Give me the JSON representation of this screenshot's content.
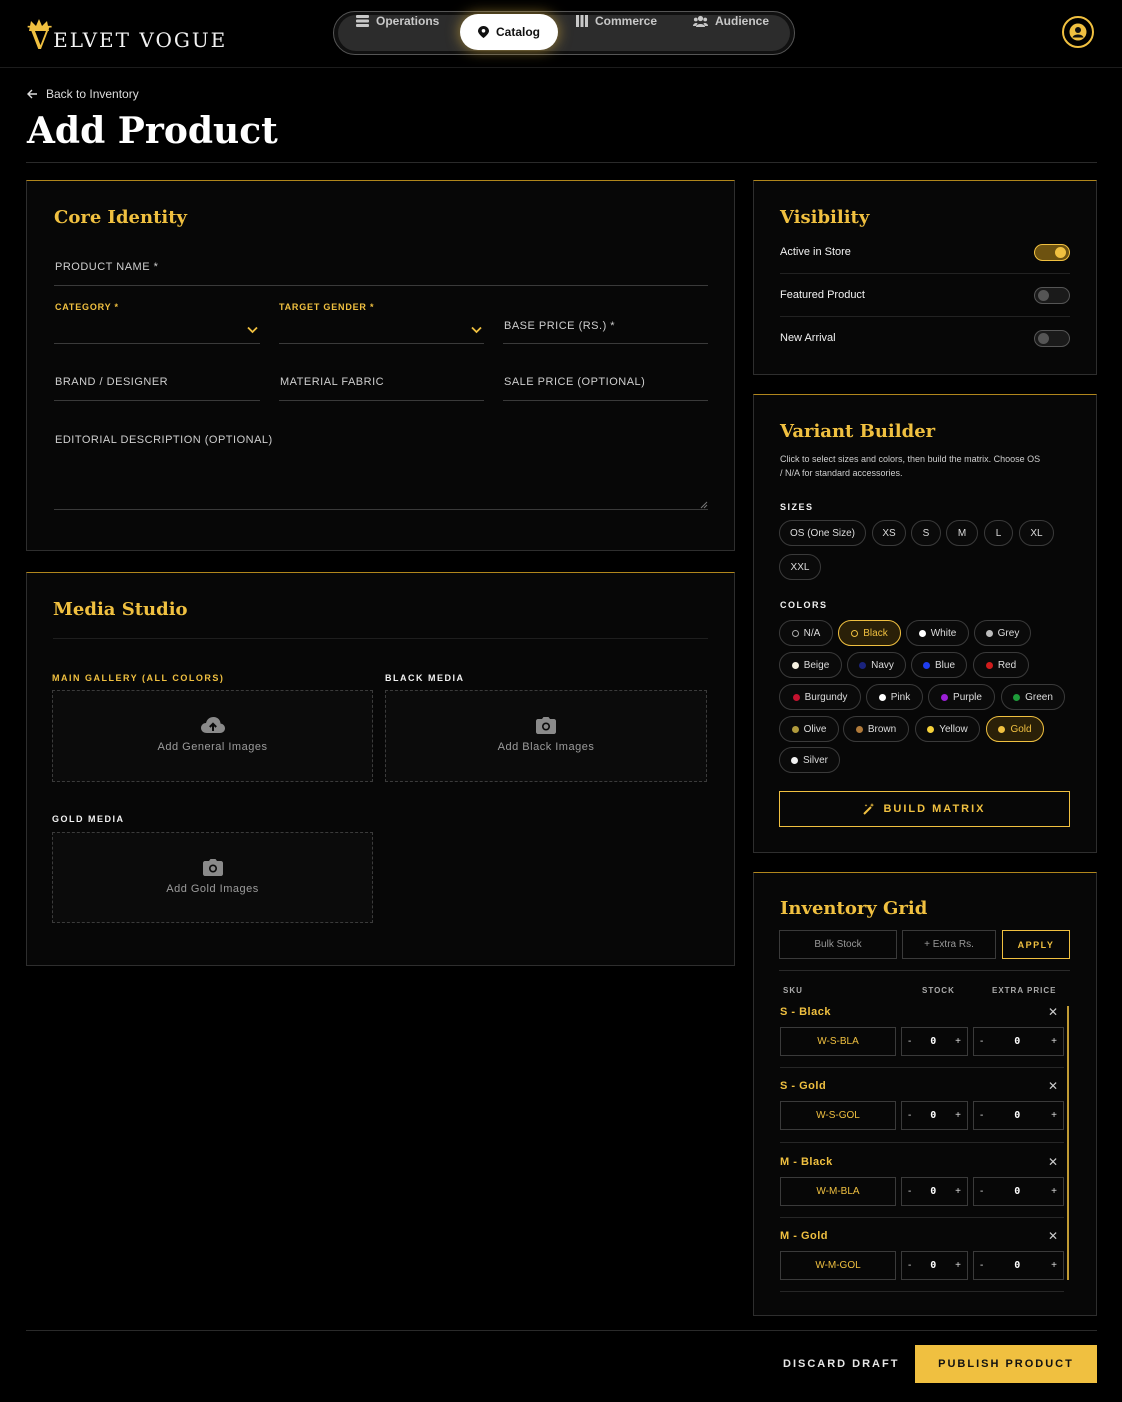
{
  "brand": {
    "first_letter": "V",
    "rest": "ELVET VOGUE"
  },
  "nav": {
    "tabs": [
      {
        "label": "Operations",
        "icon": "layers-icon"
      },
      {
        "label": "Catalog",
        "icon": "tag-icon",
        "active": true
      },
      {
        "label": "Commerce",
        "icon": "columns-icon"
      },
      {
        "label": "Audience",
        "icon": "users-icon"
      }
    ]
  },
  "page": {
    "back_label": "Back to Inventory",
    "title": "Add Product"
  },
  "core": {
    "title": "Core Identity",
    "product_name_label": "PRODUCT NAME *",
    "category_label": "CATEGORY *",
    "target_gender_label": "TARGET GENDER *",
    "base_price_label": "BASE PRICE (RS.) *",
    "brand_label": "BRAND / DESIGNER",
    "material_label": "MATERIAL FABRIC",
    "sale_price_label": "SALE PRICE (OPTIONAL)",
    "description_label": "EDITORIAL DESCRIPTION (OPTIONAL)"
  },
  "media": {
    "title": "Media Studio",
    "main_label": "MAIN GALLERY (ALL COLORS)",
    "main_add": "Add General Images",
    "black_label": "BLACK MEDIA",
    "black_add": "Add Black Images",
    "gold_label": "GOLD MEDIA",
    "gold_add": "Add Gold Images"
  },
  "visibility": {
    "title": "Visibility",
    "items": [
      {
        "label": "Active in Store",
        "on": true
      },
      {
        "label": "Featured Product",
        "on": false
      },
      {
        "label": "New Arrival",
        "on": false
      }
    ]
  },
  "variant": {
    "title": "Variant Builder",
    "desc_line1": "Click to select sizes and colors, then build the matrix. Choose OS",
    "desc_line2": "/ N/A for standard accessories.",
    "sizes_label": "SIZES",
    "sizes": [
      "OS (One Size)",
      "XS",
      "S",
      "M",
      "L",
      "XL",
      "XXL"
    ],
    "colors_label": "COLORS",
    "colors": [
      {
        "name": "N/A",
        "hex": "",
        "selected": false
      },
      {
        "name": "Black",
        "hex": "#000000",
        "selected": true
      },
      {
        "name": "White",
        "hex": "#ffffff",
        "selected": false
      },
      {
        "name": "Grey",
        "hex": "#bdbdbd",
        "selected": false
      },
      {
        "name": "Beige",
        "hex": "#f5f0e1",
        "selected": false
      },
      {
        "name": "Navy",
        "hex": "#1a237e",
        "selected": false
      },
      {
        "name": "Blue",
        "hex": "#1e3df0",
        "selected": false
      },
      {
        "name": "Red",
        "hex": "#d01c1c",
        "selected": false
      },
      {
        "name": "Burgundy",
        "hex": "#c4122f",
        "selected": false
      },
      {
        "name": "Pink",
        "hex": "#ffffff",
        "selected": false
      },
      {
        "name": "Purple",
        "hex": "#9b1fd6",
        "selected": false
      },
      {
        "name": "Green",
        "hex": "#1e9c3a",
        "selected": false
      },
      {
        "name": "Olive",
        "hex": "#b09a3c",
        "selected": false
      },
      {
        "name": "Brown",
        "hex": "#b07a3a",
        "selected": false
      },
      {
        "name": "Yellow",
        "hex": "#f6d23a",
        "selected": false
      },
      {
        "name": "Gold",
        "hex": "#f0c040",
        "selected": true
      },
      {
        "name": "Silver",
        "hex": "#f2f2f2",
        "selected": false
      }
    ],
    "build_label": "BUILD MATRIX"
  },
  "inventory": {
    "title": "Inventory Grid",
    "bulk_stock_placeholder": "Bulk Stock",
    "extra_placeholder": "+ Extra Rs.",
    "apply_label": "APPLY",
    "col_sku": "SKU",
    "col_stock": "STOCK",
    "col_extra": "EXTRA PRICE",
    "rows": [
      {
        "name": "S - Black",
        "sku": "W-S-BLA",
        "stock": "0",
        "extra": "0"
      },
      {
        "name": "S - Gold",
        "sku": "W-S-GOL",
        "stock": "0",
        "extra": "0"
      },
      {
        "name": "M - Black",
        "sku": "W-M-BLA",
        "stock": "0",
        "extra": "0"
      },
      {
        "name": "M - Gold",
        "sku": "W-M-GOL",
        "stock": "0",
        "extra": "0"
      }
    ]
  },
  "footer": {
    "discard_label": "DISCARD DRAFT",
    "publish_label": "PUBLISH PRODUCT"
  },
  "theme": {
    "accent": "#f0c040",
    "background": "#000000"
  }
}
